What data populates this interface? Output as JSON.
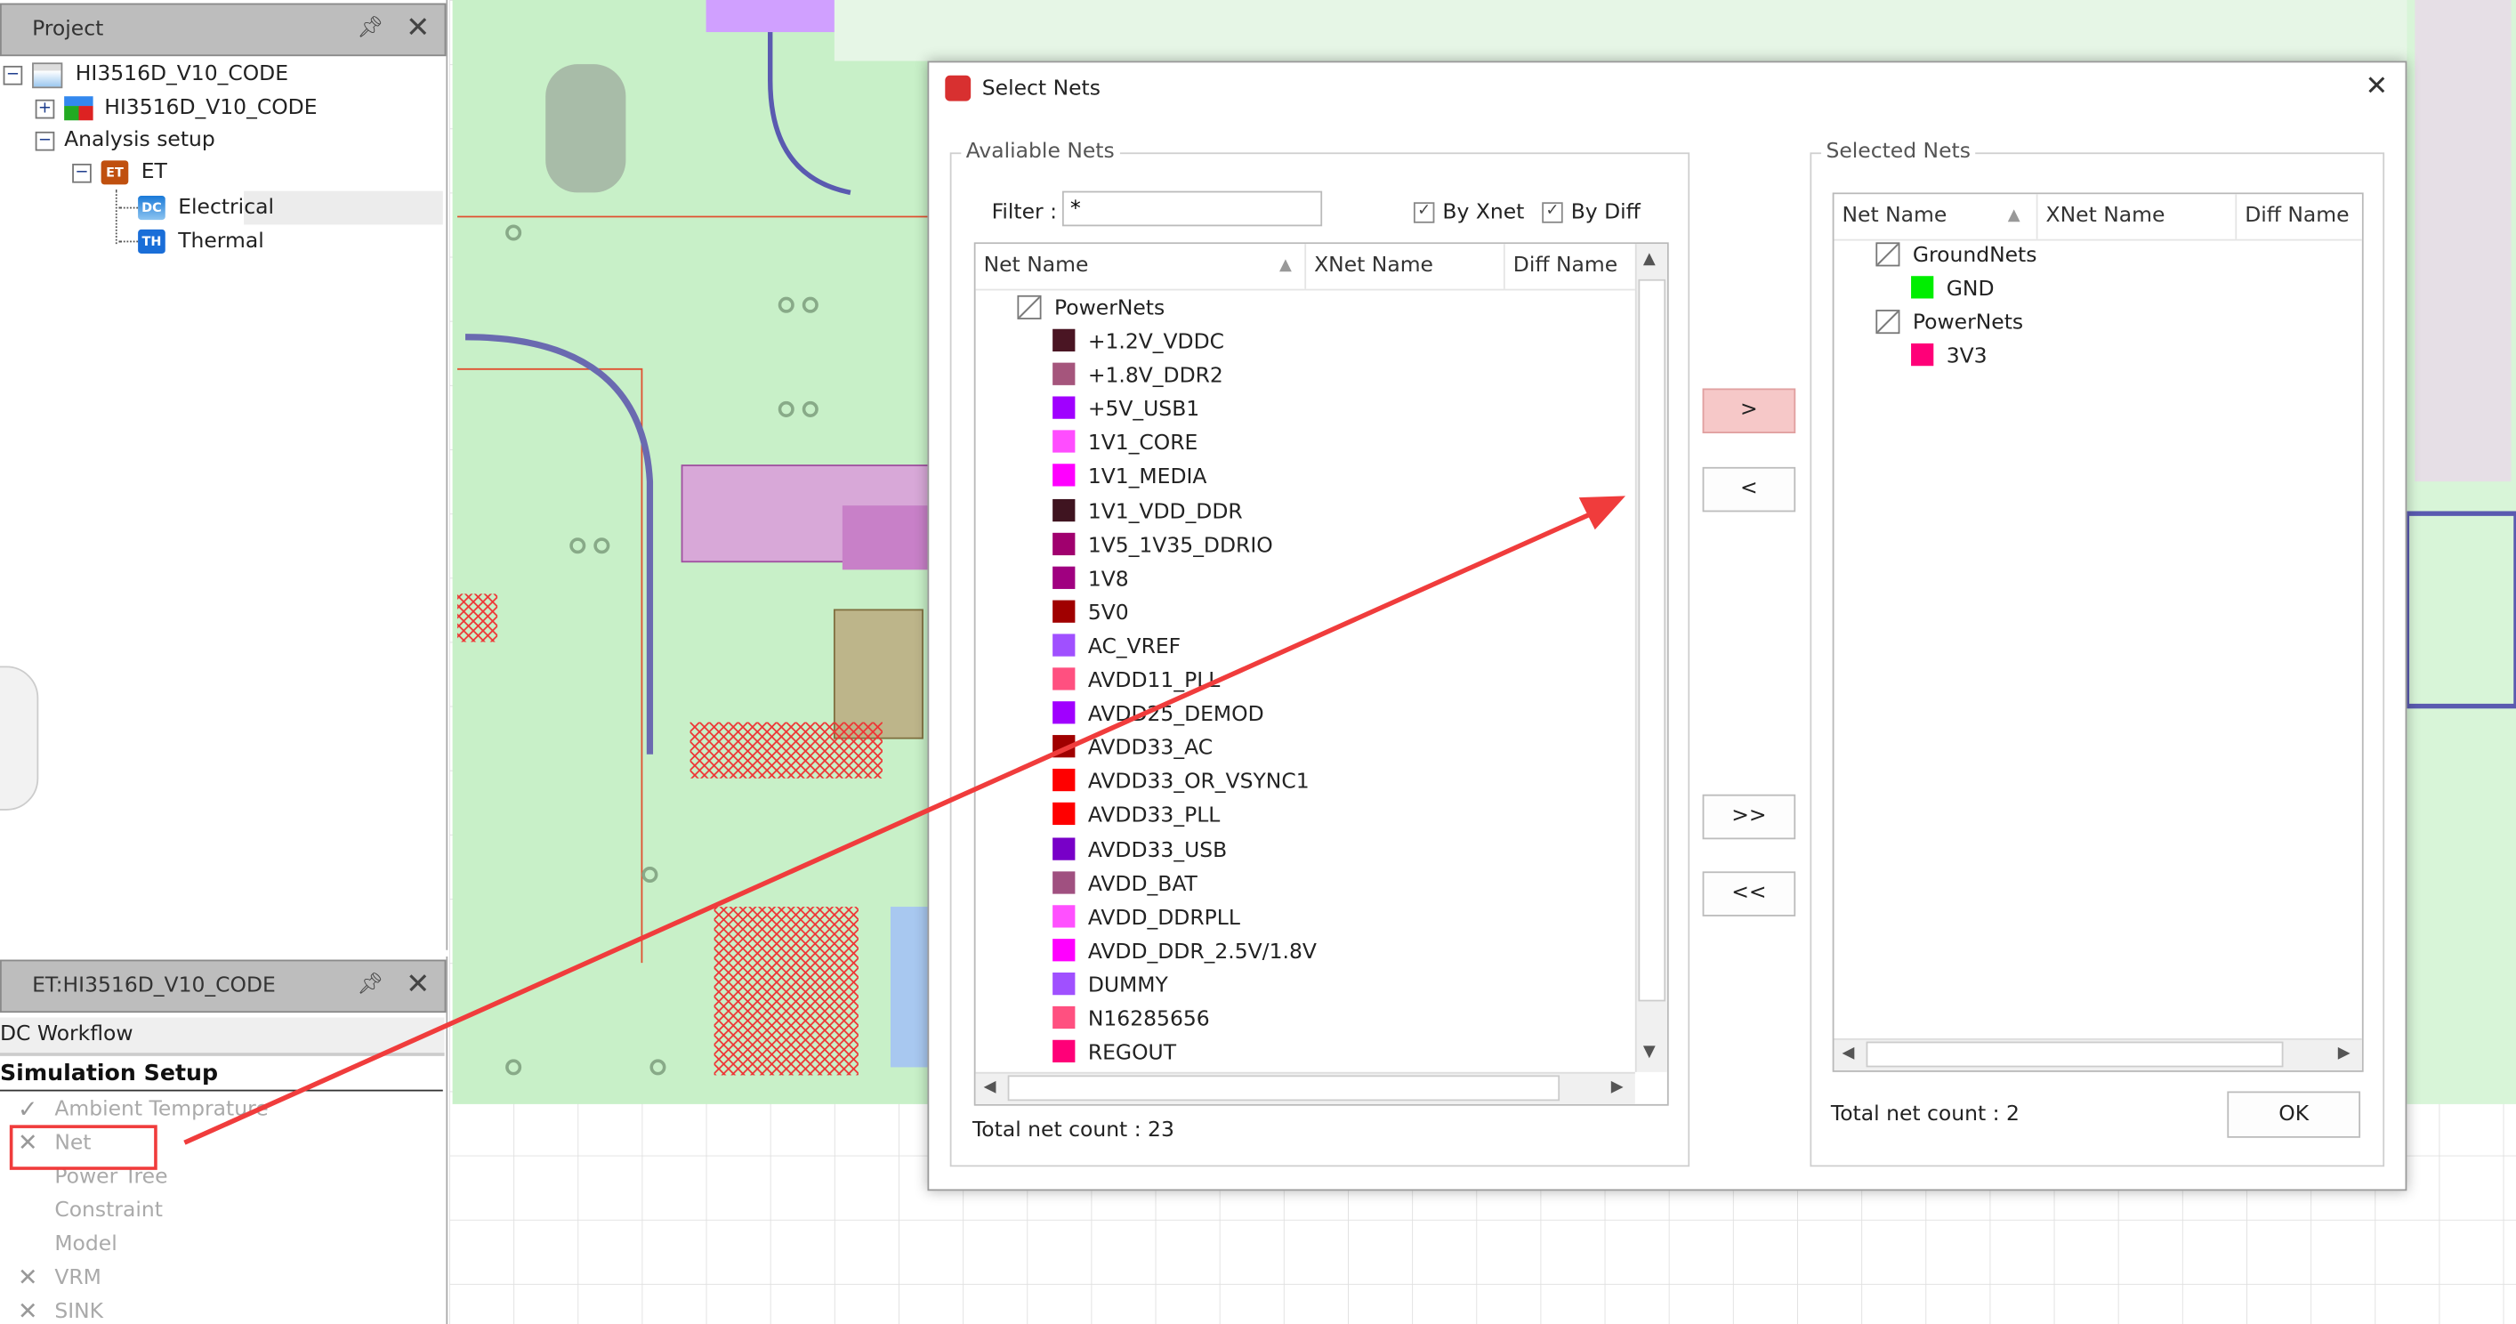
{
  "project_panel": {
    "title": "Project",
    "tree": [
      {
        "label": "HI3516D_V10_CODE",
        "icon": "project-file-icon",
        "expander": "−"
      },
      {
        "label": "HI3516D_V10_CODE",
        "icon": "design-blocks-icon",
        "expander": "+"
      },
      {
        "label": "Analysis setup",
        "expander": "−"
      },
      {
        "label": "ET",
        "icon": "et-badge-icon",
        "badge": "ET",
        "expander": "−"
      },
      {
        "label": "Electrical",
        "icon": "dc-badge-icon",
        "badge": "DC",
        "selected": true
      },
      {
        "label": "Thermal",
        "icon": "th-badge-icon",
        "badge": "TH"
      }
    ]
  },
  "workflow_panel": {
    "title": "ET:HI3516D_V10_CODE",
    "tab": "DC Workflow",
    "section": "Simulation Setup",
    "items": [
      {
        "label": "Ambient Temprature",
        "status": "check"
      },
      {
        "label": "Net",
        "status": "cross",
        "highlighted": true
      },
      {
        "label": "Power Tree",
        "status": "none"
      },
      {
        "label": "Constraint",
        "status": "none"
      },
      {
        "label": "Model",
        "status": "none"
      },
      {
        "label": "VRM",
        "status": "cross"
      },
      {
        "label": "SINK",
        "status": "cross"
      }
    ]
  },
  "dialog": {
    "title": "Select Nets",
    "close": "✕",
    "available": {
      "legend": "Avaliable Nets",
      "filter_label": "Filter :",
      "filter_value": "*",
      "by_xnet": {
        "label": "By Xnet",
        "checked": true
      },
      "by_diff": {
        "label": "By Diff",
        "checked": true
      },
      "columns": [
        "Net Name",
        "XNet Name",
        "Diff Name"
      ],
      "group": "PowerNets",
      "nets": [
        {
          "name": "+1.2V_VDDC",
          "color": "#4a1523"
        },
        {
          "name": "+1.8V_DDR2",
          "color": "#a5557c"
        },
        {
          "name": "+5V_USB1",
          "color": "#a000ff"
        },
        {
          "name": "1V1_CORE",
          "color": "#ff4dff"
        },
        {
          "name": "1V1_MEDIA",
          "color": "#ff00ff"
        },
        {
          "name": "1V1_VDD_DDR",
          "color": "#3f1420"
        },
        {
          "name": "1V5_1V35_DDRIO",
          "color": "#a0006e"
        },
        {
          "name": "1V8",
          "color": "#a00080"
        },
        {
          "name": "5V0",
          "color": "#a00000"
        },
        {
          "name": "AC_VREF",
          "color": "#a050ff"
        },
        {
          "name": "AVDD11_PLL",
          "color": "#ff5080"
        },
        {
          "name": "AVDD25_DEMOD",
          "color": "#a000ff"
        },
        {
          "name": "AVDD33_AC",
          "color": "#a00000"
        },
        {
          "name": "AVDD33_OR_VSYNC1",
          "color": "#ff0000"
        },
        {
          "name": "AVDD33_PLL",
          "color": "#ff0000"
        },
        {
          "name": "AVDD33_USB",
          "color": "#7800c8"
        },
        {
          "name": "AVDD_BAT",
          "color": "#a05080"
        },
        {
          "name": "AVDD_DDRPLL",
          "color": "#ff50ff"
        },
        {
          "name": "AVDD_DDR_2.5V/1.8V",
          "color": "#ff00ff"
        },
        {
          "name": "DUMMY",
          "color": "#a050ff"
        },
        {
          "name": "N16285656",
          "color": "#ff5080"
        },
        {
          "name": "REGOUT",
          "color": "#ff0078"
        }
      ],
      "total": "Total net count : 23"
    },
    "buttons": {
      "add": ">",
      "remove": "<",
      "add_all": ">>",
      "remove_all": "<<"
    },
    "selected": {
      "legend": "Selected Nets",
      "columns": [
        "Net Name",
        "XNet Name",
        "Diff Name"
      ],
      "groups": [
        {
          "name": "GroundNets",
          "nets": [
            {
              "name": "GND",
              "color": "#00ee00"
            }
          ]
        },
        {
          "name": "PowerNets",
          "nets": [
            {
              "name": "3V3",
              "color": "#ff0078"
            }
          ]
        }
      ],
      "total": "Total net count : 2"
    },
    "ok": "OK"
  },
  "colors": {
    "annotation": "#f03c3c",
    "pcb_background": "#c8f0c8",
    "add_button": "#f6c8c8"
  }
}
